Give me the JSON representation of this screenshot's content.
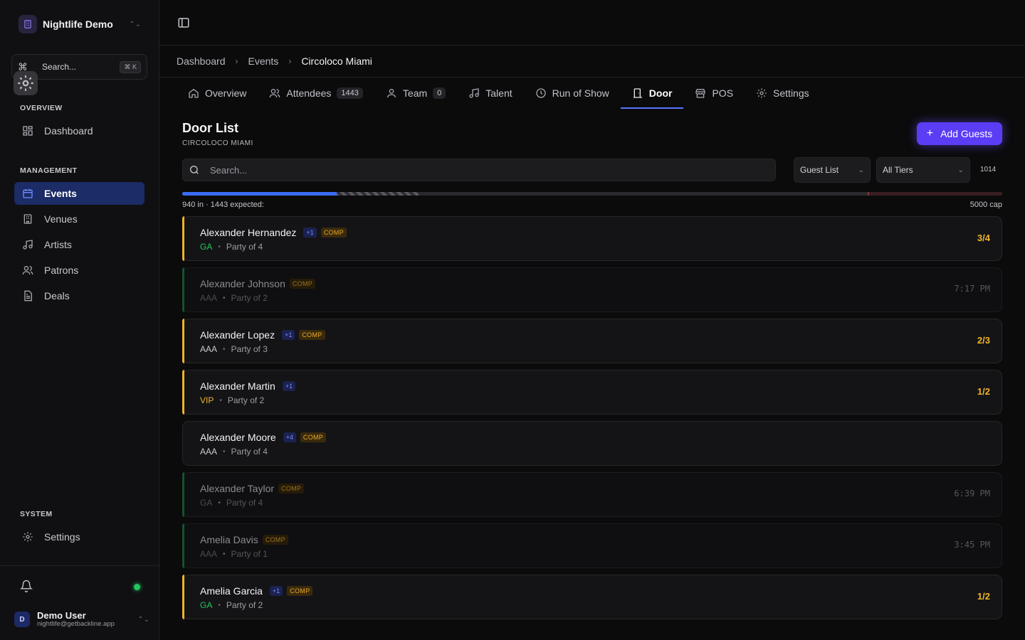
{
  "workspace": {
    "name": "Nightlife Demo"
  },
  "sidebar": {
    "search_label": "Search...",
    "search_kbd": "⌘ K",
    "overview_label": "OVERVIEW",
    "management_label": "MANAGEMENT",
    "system_label": "SYSTEM",
    "items": [
      {
        "label": "Dashboard",
        "icon": "dashboard-icon"
      },
      {
        "label": "Events",
        "icon": "calendar-icon",
        "active": true
      },
      {
        "label": "Venues",
        "icon": "building-icon"
      },
      {
        "label": "Artists",
        "icon": "music-icon"
      },
      {
        "label": "Patrons",
        "icon": "users-icon"
      },
      {
        "label": "Deals",
        "icon": "document-icon"
      },
      {
        "label": "Settings",
        "icon": "gear-icon"
      }
    ]
  },
  "user": {
    "initial": "D",
    "name": "Demo User",
    "email": "nightlife@getbackline.app"
  },
  "breadcrumb": [
    "Dashboard",
    "Events",
    "Circoloco Miami"
  ],
  "tabs": [
    {
      "label": "Overview",
      "icon": "home-icon"
    },
    {
      "label": "Attendees",
      "icon": "users-icon",
      "count": "1443"
    },
    {
      "label": "Team",
      "icon": "user-icon",
      "count": "0"
    },
    {
      "label": "Talent",
      "icon": "music-icon"
    },
    {
      "label": "Run of Show",
      "icon": "clock-icon"
    },
    {
      "label": "Door",
      "icon": "door-icon",
      "active": true
    },
    {
      "label": "POS",
      "icon": "store-icon"
    },
    {
      "label": "Settings",
      "icon": "gear-icon"
    }
  ],
  "door": {
    "title": "Door List",
    "subtitle": "CIRCOLOCO MIAMI",
    "add_button": "Add Guests",
    "search_placeholder": "Search...",
    "filter_list": "Guest List",
    "filter_tier": "All Tiers",
    "total": "1014",
    "progress_text": "940 in · 1443 expected:",
    "cap_text": "5000 cap",
    "checked_in": 940,
    "expected": 1443,
    "capacity": 5000
  },
  "guests": [
    {
      "name": "Alexander Hernandez",
      "plus": "+1",
      "comp": "COMP",
      "tier": "GA",
      "party": "Party of 4",
      "status": "pending",
      "right": "3/4"
    },
    {
      "name": "Alexander Johnson",
      "plus": "",
      "comp": "COMP",
      "tier": "AAA",
      "party": "Party of 2",
      "status": "checked",
      "right": "7:17 PM"
    },
    {
      "name": "Alexander Lopez",
      "plus": "+1",
      "comp": "COMP",
      "tier": "AAA",
      "party": "Party of 3",
      "status": "pending",
      "right": "2/3"
    },
    {
      "name": "Alexander Martin",
      "plus": "+1",
      "comp": "",
      "tier": "VIP",
      "party": "Party of 2",
      "status": "pending",
      "right": "1/2"
    },
    {
      "name": "Alexander Moore",
      "plus": "+4",
      "comp": "COMP",
      "tier": "AAA",
      "party": "Party of 4",
      "status": "none",
      "right": ""
    },
    {
      "name": "Alexander Taylor",
      "plus": "",
      "comp": "COMP",
      "tier": "GA",
      "party": "Party of 4",
      "status": "checked",
      "right": "6:39 PM"
    },
    {
      "name": "Amelia Davis",
      "plus": "",
      "comp": "COMP",
      "tier": "AAA",
      "party": "Party of 1",
      "status": "checked",
      "right": "3:45 PM"
    },
    {
      "name": "Amelia Garcia",
      "plus": "+1",
      "comp": "COMP",
      "tier": "GA",
      "party": "Party of 2",
      "status": "pending",
      "right": "1/2"
    }
  ],
  "colors": {
    "accent": "#5b3df5",
    "active_nav": "#1b2c66",
    "pending": "#f0b429",
    "ga": "#22c55e",
    "tab_underline": "#5b74ff"
  }
}
